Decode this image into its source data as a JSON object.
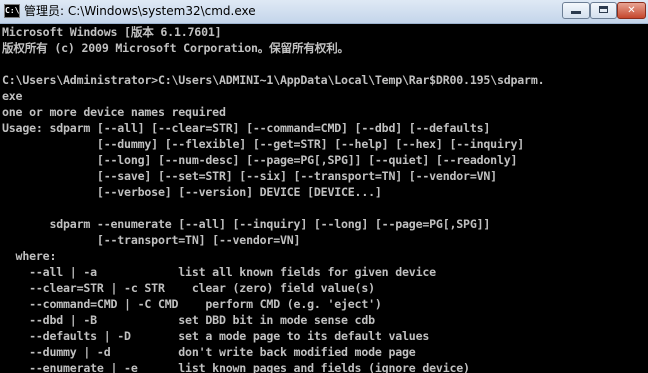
{
  "window": {
    "title": "管理员: C:\\Windows\\system32\\cmd.exe",
    "icon_text": "C:\\",
    "icon": "console-icon",
    "controls": {
      "minimize": "minimize-icon",
      "maximize": "maximize-icon",
      "close": "✕"
    }
  },
  "colors": {
    "console_background": "#000000",
    "console_text": "#c0c0c0",
    "close_button": "#c5472d"
  },
  "console": {
    "lines": [
      "Microsoft Windows [版本 6.1.7601]",
      "版权所有 (c) 2009 Microsoft Corporation。保留所有权利。",
      "",
      "C:\\Users\\Administrator>C:\\Users\\ADMINI~1\\AppData\\Local\\Temp\\Rar$DR00.195\\sdparm.",
      "exe",
      "one or more device names required",
      "Usage: sdparm [--all] [--clear=STR] [--command=CMD] [--dbd] [--defaults]",
      "              [--dummy] [--flexible] [--get=STR] [--help] [--hex] [--inquiry]",
      "              [--long] [--num-desc] [--page=PG[,SPG]] [--quiet] [--readonly]",
      "              [--save] [--set=STR] [--six] [--transport=TN] [--vendor=VN]",
      "              [--verbose] [--version] DEVICE [DEVICE...]",
      "",
      "       sdparm --enumerate [--all] [--inquiry] [--long] [--page=PG[,SPG]]",
      "              [--transport=TN] [--vendor=VN]",
      "  where:",
      "    --all | -a            list all known fields for given device",
      "    --clear=STR | -c STR    clear (zero) field value(s)",
      "    --command=CMD | -C CMD    perform CMD (e.g. 'eject')",
      "    --dbd | -B            set DBD bit in mode sense cdb",
      "    --defaults | -D       set a mode page to its default values",
      "    --dummy | -d          don't write back modified mode page",
      "    --enumerate | -e      list known pages and fields (ignore device)"
    ]
  }
}
